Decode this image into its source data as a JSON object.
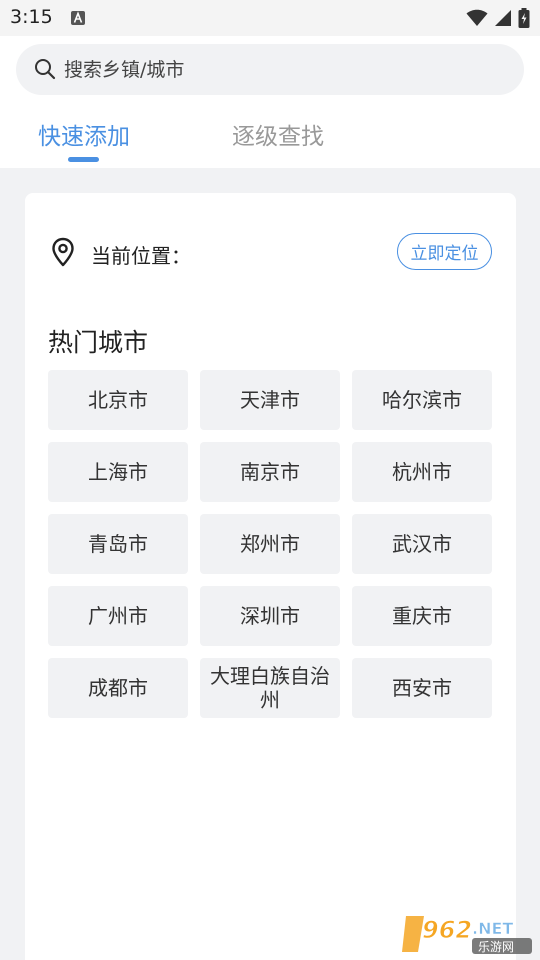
{
  "status_bar": {
    "time": "3:15"
  },
  "search": {
    "placeholder": "搜索乡镇/城市"
  },
  "tabs": [
    {
      "label": "快速添加",
      "active": true
    },
    {
      "label": "逐级查找",
      "active": false
    }
  ],
  "location": {
    "label": "当前位置：",
    "button": "立即定位"
  },
  "hot_cities": {
    "title": "热门城市",
    "cities": [
      "北京市",
      "天津市",
      "哈尔滨市",
      "上海市",
      "南京市",
      "杭州市",
      "青岛市",
      "郑州市",
      "武汉市",
      "广州市",
      "深圳市",
      "重庆市",
      "成都市",
      "大理白族自治州",
      "西安市"
    ]
  },
  "watermark": {
    "brand": "962.NET",
    "sub": "乐游网"
  },
  "colors": {
    "accent": "#4a90e2",
    "chip_bg": "#f1f2f4",
    "page_bg": "#f1f2f4"
  }
}
